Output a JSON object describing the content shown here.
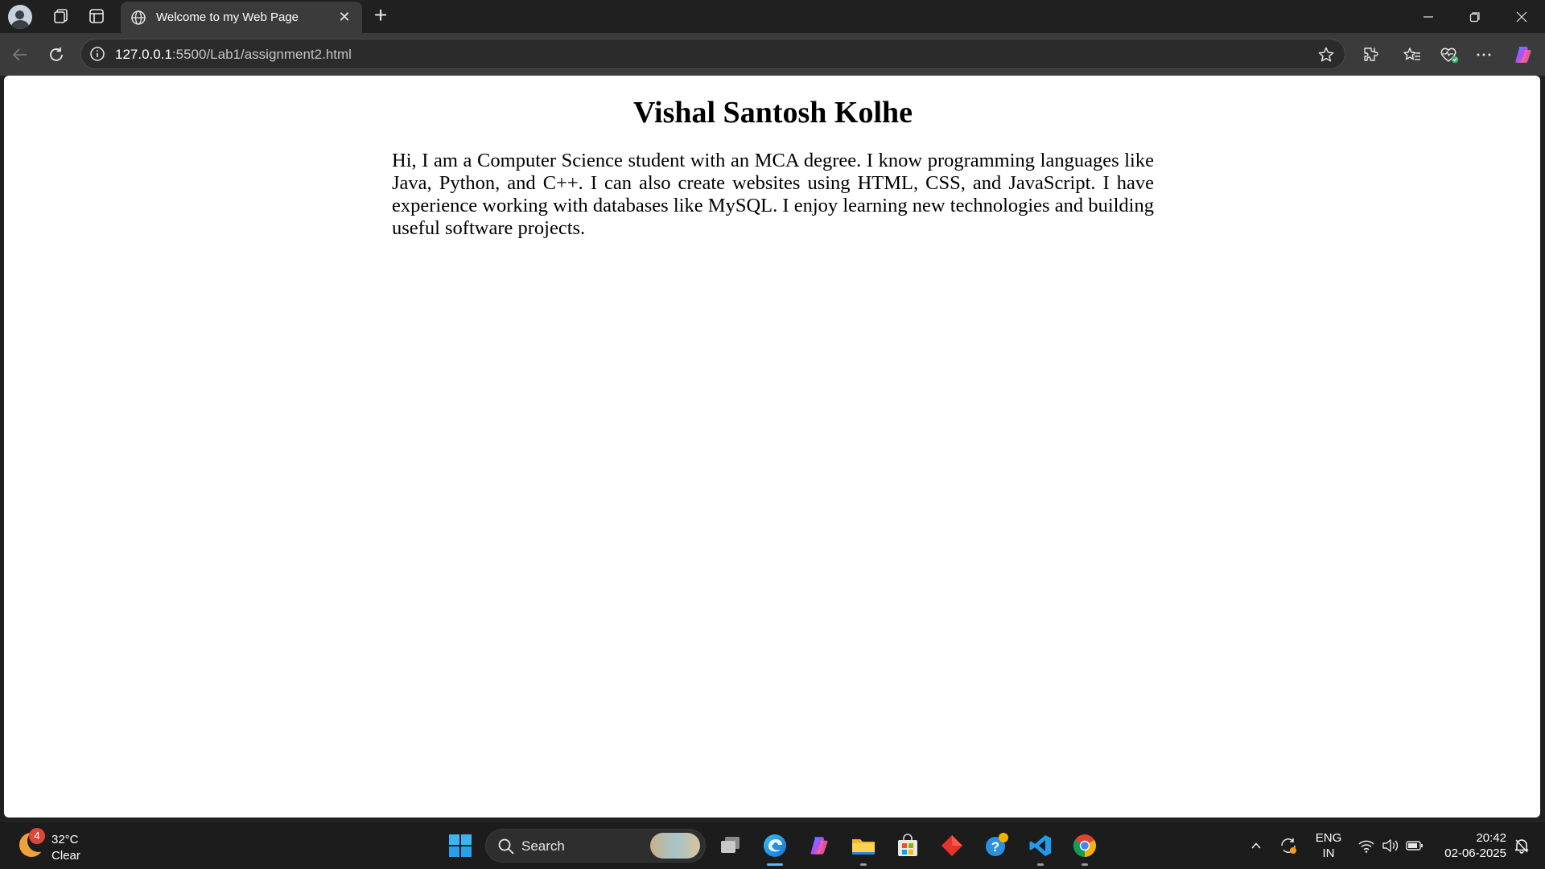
{
  "browser": {
    "tab_title": "Welcome to my Web Page",
    "url_host": "127.0.0.1",
    "url_rest": ":5500/Lab1/assignment2.html"
  },
  "page": {
    "heading": "Vishal Santosh Kolhe",
    "paragraph": "Hi, I am a Computer Science student with an MCA degree. I know programming languages like Java, Python, and C++. I can also create websites using HTML, CSS, and JavaScript. I have experience working with databases like MySQL. I enjoy learning new technologies and building useful software projects."
  },
  "taskbar": {
    "weather_badge": "4",
    "weather_temp": "32°C",
    "weather_condition": "Clear",
    "search_label": "Search",
    "language_line1": "ENG",
    "language_line2": "IN",
    "time": "20:42",
    "date": "02-06-2025"
  },
  "icons": {
    "tab_bar": [
      "profile-avatar",
      "workspaces-icon",
      "tab-actions-icon",
      "globe-icon",
      "close-icon",
      "new-tab-icon",
      "minimize-icon",
      "restore-icon",
      "window-close-icon"
    ],
    "toolbar": [
      "back-icon",
      "refresh-icon",
      "info-icon",
      "favorite-star-icon",
      "extensions-icon",
      "favorites-icon",
      "browser-essentials-icon",
      "more-icon",
      "copilot-icon"
    ],
    "taskbar": [
      "windows-start-icon",
      "search-icon",
      "task-view-icon",
      "edge-icon",
      "copilot-icon",
      "file-explorer-icon",
      "microsoft-store-icon",
      "red-app-icon",
      "help-icon",
      "vscode-icon",
      "chrome-icon"
    ]
  },
  "colors": {
    "chrome_dark": "#202020",
    "toolbar": "#3b3b3b",
    "page_bg": "#ffffff",
    "accent_edge": "#38a8f5"
  }
}
